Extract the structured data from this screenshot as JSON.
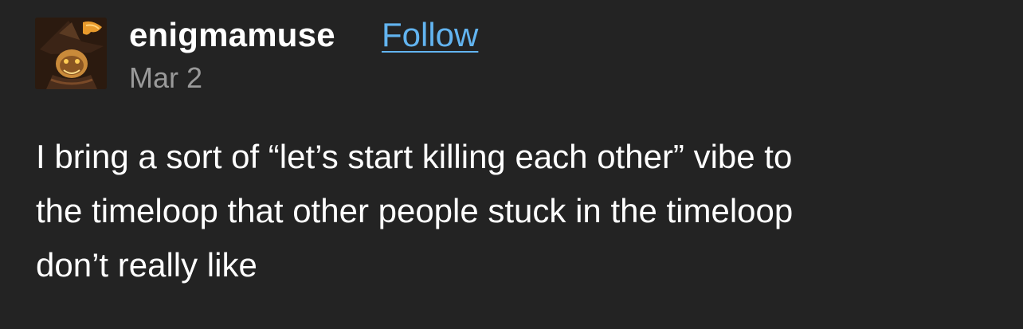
{
  "post": {
    "username": "enigmamuse",
    "follow_label": "Follow",
    "date": "Mar 2",
    "body_lines": [
      "I bring a sort of “let’s start killing each other” vibe to",
      "the timeloop that other people stuck in the timeloop",
      "don’t really like"
    ]
  },
  "colors": {
    "background": "#232323",
    "username": "#ffffff",
    "follow_link": "#62b4f0",
    "date": "#9a9a9a",
    "body_text": "#ffffff"
  }
}
